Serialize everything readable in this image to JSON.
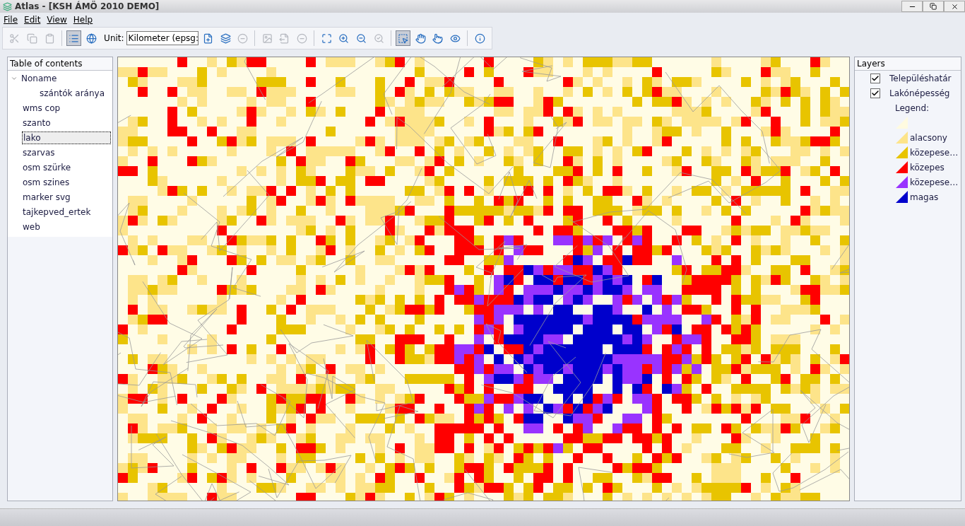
{
  "window": {
    "title": "Atlas - [KSH ÁMÖ 2010 DEMO]"
  },
  "menu": [
    "File",
    "Edit",
    "View",
    "Help"
  ],
  "toolbar": [
    {
      "kind": "cut",
      "disabled": true
    },
    {
      "kind": "copy",
      "disabled": true
    },
    {
      "kind": "paste",
      "disabled": true
    },
    {
      "kind": "sep"
    },
    {
      "kind": "list",
      "disabled": false,
      "selected": true
    },
    {
      "kind": "globe",
      "disabled": false
    },
    {
      "kind": "unit",
      "label": "Unit:",
      "value": "Kilometer (epsg:"
    },
    {
      "kind": "add",
      "disabled": false
    },
    {
      "kind": "addlayer",
      "disabled": false
    },
    {
      "kind": "remove",
      "disabled": true
    },
    {
      "kind": "sep"
    },
    {
      "kind": "image",
      "disabled": true
    },
    {
      "kind": "export",
      "disabled": true
    },
    {
      "kind": "remove",
      "disabled": true
    },
    {
      "kind": "sep"
    },
    {
      "kind": "extent",
      "disabled": false
    },
    {
      "kind": "zoomin",
      "disabled": false
    },
    {
      "kind": "zoomout",
      "disabled": false
    },
    {
      "kind": "zoomsel",
      "disabled": true
    },
    {
      "kind": "sep"
    },
    {
      "kind": "select",
      "disabled": false,
      "selected": true
    },
    {
      "kind": "pan",
      "disabled": false
    },
    {
      "kind": "identify",
      "disabled": false
    },
    {
      "kind": "eye",
      "disabled": false
    },
    {
      "kind": "sep"
    },
    {
      "kind": "info",
      "disabled": false
    }
  ],
  "toc": {
    "title": "Table of contents",
    "items": [
      {
        "label": "Noname",
        "selected": false,
        "expanded": true,
        "children": [
          {
            "label": "szántók aránya",
            "selected": false
          }
        ]
      },
      {
        "label": "wms cop",
        "selected": false
      },
      {
        "label": "szanto",
        "selected": false
      },
      {
        "label": "lako",
        "selected": true
      },
      {
        "label": "szarvas",
        "selected": false
      },
      {
        "label": "osm szürke",
        "selected": false
      },
      {
        "label": "osm szines",
        "selected": false
      },
      {
        "label": "marker svg",
        "selected": false
      },
      {
        "label": "tajkepved_ertek",
        "selected": false
      },
      {
        "label": "web",
        "selected": false
      }
    ]
  },
  "layers": {
    "title": "Layers",
    "items": [
      {
        "label": "Településhatár",
        "checked": true
      },
      {
        "label": "Lakónépesség",
        "checked": true,
        "legend_title": "Legend:",
        "legend": [
          {
            "color": "#fffbe0"
          },
          {
            "label": "alacsony",
            "color": "#fde48a"
          },
          {
            "label": "közepese…",
            "color": "#e8c400"
          },
          {
            "label": "közepes",
            "color": "#ff0000"
          },
          {
            "label": "közepese…",
            "color": "#9933ff"
          },
          {
            "label": "magas",
            "color": "#0000cc"
          }
        ]
      }
    ]
  }
}
